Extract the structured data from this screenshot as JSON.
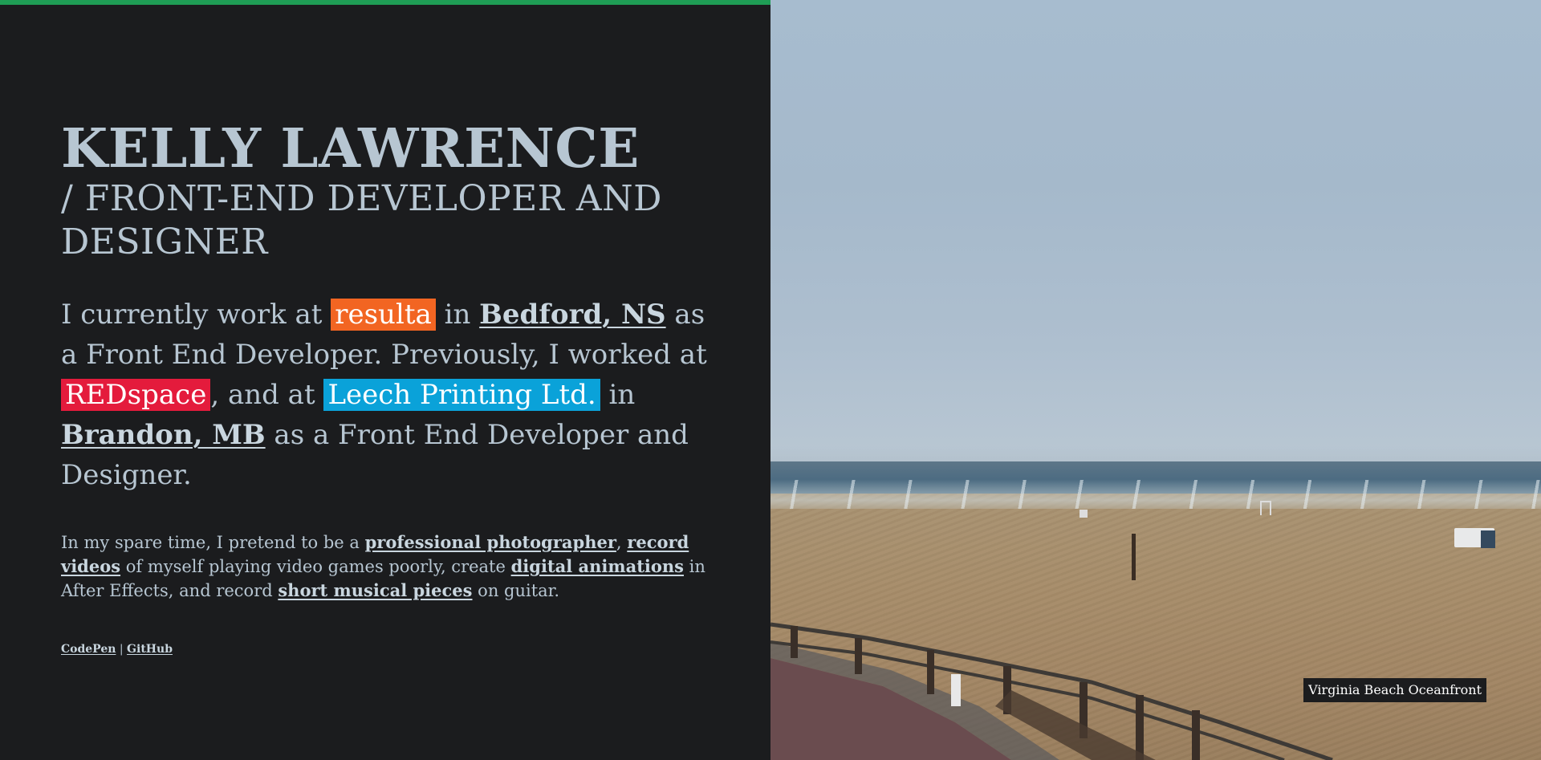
{
  "hero": {
    "name": "KELLY LAWRENCE",
    "role": "/ FRONT-END DEVELOPER AND DESIGNER"
  },
  "intro": {
    "t1": "I currently work at ",
    "company1": "resulta",
    "t2": " in ",
    "location1": "Bedford, NS",
    "t3": " as a Front End Developer. Previously, I worked at ",
    "company2": "REDspace",
    "t4": ", and at ",
    "company3": "Leech Printing Ltd.",
    "t5": " in ",
    "location2": "Brandon, MB",
    "t6": " as a Front End Developer and Designer."
  },
  "spare_time": {
    "t1": "In my spare time, I pretend to be a ",
    "link_photographer": "professional photographer",
    "t2": ", ",
    "link_videos": "record videos",
    "t3": " of myself playing video games poorly, create ",
    "link_animations": "digital animations",
    "t4": " in After Effects, and record ",
    "link_music": "short musical pieces",
    "t5": " on guitar."
  },
  "social": {
    "codepen": "CodePen",
    "separator": " | ",
    "github": "GitHub"
  },
  "photo": {
    "caption": "Virginia Beach Oceanfront"
  },
  "colors": {
    "accent_bar": "#1f9d55",
    "resulta": "#f26522",
    "redspace": "#e41b3c",
    "leech": "#0aa2d9",
    "background": "#1b1c1e",
    "text": "#b7c6d2"
  }
}
